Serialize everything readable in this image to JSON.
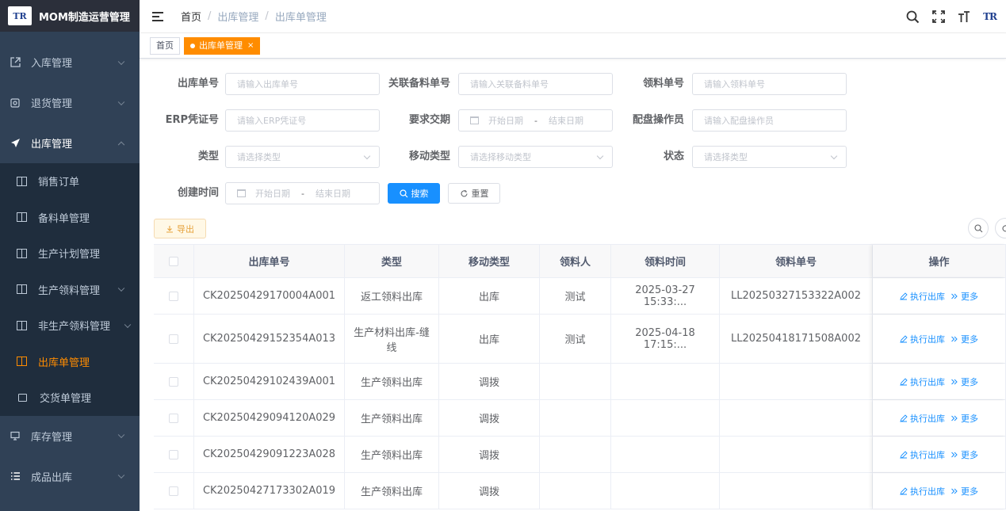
{
  "app": {
    "logo_text": "TR",
    "title": "MOM制造运营管理"
  },
  "sidebar": {
    "items": [
      {
        "label": "入库管理"
      },
      {
        "label": "退货管理"
      },
      {
        "label": "出库管理"
      },
      {
        "label": "库存管理"
      },
      {
        "label": "成品出库"
      }
    ],
    "sub_items": [
      {
        "label": "销售订单"
      },
      {
        "label": "备料单管理"
      },
      {
        "label": "生产计划管理"
      },
      {
        "label": "生产领料管理"
      },
      {
        "label": "非生产领料管理"
      },
      {
        "label": "出库单管理"
      },
      {
        "label": "交货单管理"
      }
    ]
  },
  "breadcrumb": {
    "home": "首页",
    "level1": "出库管理",
    "level2": "出库单管理"
  },
  "tags": {
    "home": "首页",
    "active": "出库单管理",
    "close": "×"
  },
  "form": {
    "out_no_label": "出库单号",
    "out_no_placeholder": "请输入出库单号",
    "prep_no_label": "关联备料单号",
    "prep_no_placeholder": "请输入关联备料单号",
    "pick_no_label": "领料单号",
    "pick_no_placeholder": "请输入领料单号",
    "erp_label": "ERP凭证号",
    "erp_placeholder": "请输入ERP凭证号",
    "req_date_label": "要求交期",
    "start_date": "开始日期",
    "date_sep": "-",
    "end_date": "结束日期",
    "operator_label": "配盘操作员",
    "operator_placeholder": "请输入配盘操作员",
    "type_label": "类型",
    "type_placeholder": "请选择类型",
    "move_type_label": "移动类型",
    "move_type_placeholder": "请选择移动类型",
    "status_label": "状态",
    "status_placeholder": "请选择类型",
    "created_label": "创建时间",
    "search_btn": "搜索",
    "reset_btn": "重置",
    "export_btn": "导出"
  },
  "table": {
    "headers": [
      "出库单号",
      "类型",
      "移动类型",
      "领料人",
      "领料时间",
      "领料单号",
      "操作"
    ],
    "op_exec": "执行出库",
    "op_more": "更多",
    "rows": [
      {
        "no": "CK20250429170004A001",
        "type": "返工领料出库",
        "move": "出库",
        "picker": "测试",
        "time": "2025-03-27 15:33:...",
        "pick_no": "LL20250327153322A002"
      },
      {
        "no": "CK20250429152354A013",
        "type": "生产材料出库-缝线",
        "move": "出库",
        "picker": "测试",
        "time": "2025-04-18 17:15:...",
        "pick_no": "LL20250418171508A002"
      },
      {
        "no": "CK20250429102439A001",
        "type": "生产领料出库",
        "move": "调拨",
        "picker": "",
        "time": "",
        "pick_no": ""
      },
      {
        "no": "CK20250429094120A029",
        "type": "生产领料出库",
        "move": "调拨",
        "picker": "",
        "time": "",
        "pick_no": ""
      },
      {
        "no": "CK20250429091223A028",
        "type": "生产领料出库",
        "move": "调拨",
        "picker": "",
        "time": "",
        "pick_no": ""
      },
      {
        "no": "CK20250427173302A019",
        "type": "生产领料出库",
        "move": "调拨",
        "picker": "",
        "time": "",
        "pick_no": ""
      }
    ]
  },
  "colors": {
    "sidebar_bg": "#304156",
    "accent": "#ff8c00",
    "primary": "#1890ff"
  }
}
